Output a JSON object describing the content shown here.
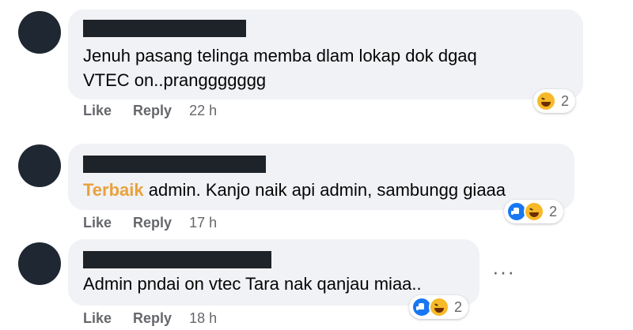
{
  "comments": [
    {
      "text": "Jenuh pasang telinga memba dlam lokap dok dgaq\nVTEC on..pranggggggg",
      "like_label": "Like",
      "reply_label": "Reply",
      "time": "22 h",
      "reaction_icons": [
        "haha-icon"
      ],
      "reaction_count": "2"
    },
    {
      "badge": "Terbaik",
      "text": " admin. Kanjo naik api admin, sambungg giaaa",
      "like_label": "Like",
      "reply_label": "Reply",
      "time": "17 h",
      "reaction_icons": [
        "like-icon",
        "haha-icon"
      ],
      "reaction_count": "2"
    },
    {
      "text": "Admin pndai on vtec Tara nak qanjau miaa..",
      "like_label": "Like",
      "reply_label": "Reply",
      "time": "18 h",
      "reaction_icons": [
        "like-icon",
        "haha-icon"
      ],
      "reaction_count": "2"
    }
  ],
  "more_options": "···",
  "colors": {
    "bubble": "#f0f2f5",
    "badge": "#e8a23c",
    "like_blue": "#1877f2",
    "haha_yellow": "#f7b928"
  }
}
